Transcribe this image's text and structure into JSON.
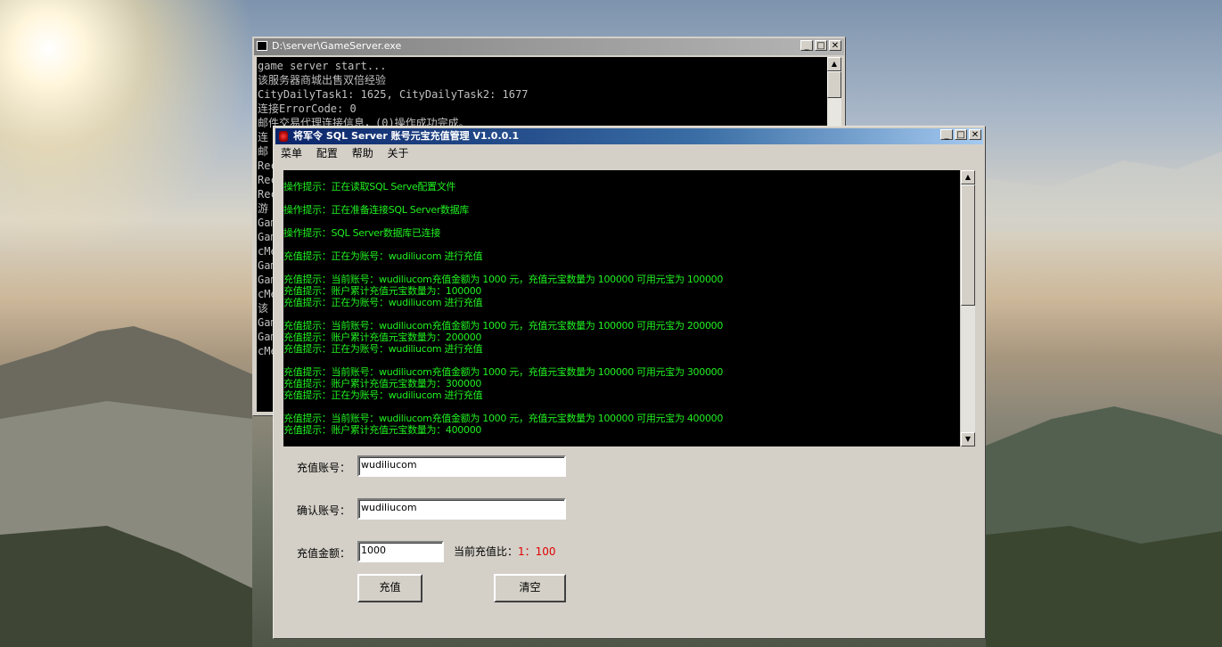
{
  "console": {
    "title": "D:\\server\\GameServer.exe",
    "lines": [
      "game server start...",
      "该服务器商城出售双倍经验",
      "CityDailyTask1: 1625, CityDailyTask2: 1677",
      "连接ErrorCode: 0",
      "邮件交易代理连接信息，(0)操作成功完成。",
      "连",
      "邮",
      "Rec",
      "Rec",
      "Rec",
      "游",
      "Gam",
      "Gam",
      "cMe",
      "Gam",
      "Gam",
      "cMe",
      "该",
      "Gam",
      "Gam",
      "cMe"
    ]
  },
  "app": {
    "title": "将军令 SQL Server 账号元宝充值管理 V1.0.0.1",
    "menu": [
      "菜单",
      "配置",
      "帮助",
      "关于"
    ],
    "log_lines": [
      "操作提示：正在读取SQL Serve配置文件",
      "",
      "操作提示：正在准备连接SQL Server数据库",
      "",
      "操作提示：SQL Server数据库已连接",
      "",
      "充值提示：正在为账号：wudiliucom 进行充值",
      "",
      "充值提示：当前账号：wudiliucom充值金额为 1000 元，充值元宝数量为 100000 可用元宝为 100000",
      "充值提示：账户累计充值元宝数量为：100000",
      "充值提示：正在为账号：wudiliucom 进行充值",
      "",
      "充值提示：当前账号：wudiliucom充值金额为 1000 元，充值元宝数量为 100000 可用元宝为 200000",
      "充值提示：账户累计充值元宝数量为：200000",
      "充值提示：正在为账号：wudiliucom 进行充值",
      "",
      "充值提示：当前账号：wudiliucom充值金额为 1000 元，充值元宝数量为 100000 可用元宝为 300000",
      "充值提示：账户累计充值元宝数量为：300000",
      "充值提示：正在为账号：wudiliucom 进行充值",
      "",
      "充值提示：当前账号：wudiliucom充值金额为 1000 元，充值元宝数量为 100000 可用元宝为 400000",
      "充值提示：账户累计充值元宝数量为：400000"
    ],
    "form": {
      "account_label": "充值账号：",
      "account_value": "wudiliucom",
      "confirm_label": "确认账号：",
      "confirm_value": "wudiliucom",
      "amount_label": "充值金额：",
      "amount_value": "1000",
      "ratio_label": "当前充值比：",
      "ratio_value": "1：100",
      "ratio_color": "#e00000",
      "recharge_button": "充值",
      "clear_button": "清空"
    }
  }
}
